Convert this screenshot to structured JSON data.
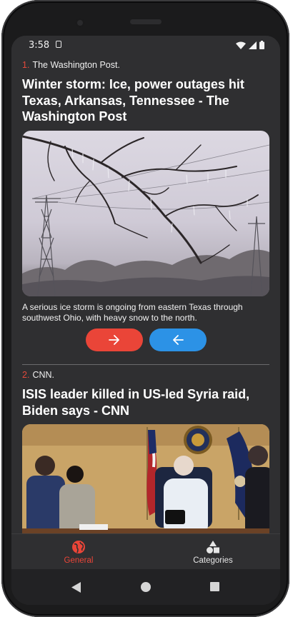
{
  "status_bar": {
    "time": "3:58",
    "icons": [
      "sim-card-icon",
      "wifi-icon",
      "signal-icon",
      "battery-icon"
    ]
  },
  "articles": [
    {
      "index": "1.",
      "source": "The Washington Post.",
      "title": "Winter storm: Ice, power outages hit Texas, Arkansas, Tennessee - The Washington Post",
      "image_alt": "Ice-covered tree branches with power lines in the background",
      "description": "A serious ice storm is ongoing from eastern Texas through southwest Ohio, with heavy snow to the north.",
      "buttons": [
        {
          "icon": "arrow-right-icon",
          "color": "#ea4538"
        },
        {
          "icon": "arrow-left-icon",
          "color": "#2c92e6"
        }
      ]
    },
    {
      "index": "2.",
      "source": "CNN.",
      "title": "ISIS leader killed in US-led Syria raid, Biden says - CNN",
      "image_alt": "Officials seated in a situation room with flags and a presidential seal"
    }
  ],
  "bottom_nav": {
    "items": [
      {
        "label": "General",
        "icon": "globe-icon",
        "active": true
      },
      {
        "label": "Categories",
        "icon": "shapes-icon",
        "active": false
      }
    ]
  },
  "system_nav": [
    "back-icon",
    "home-icon",
    "recents-icon"
  ],
  "colors": {
    "background": "#2f2f31",
    "accent": "#ea4538",
    "secondary": "#2c92e6",
    "index_number": "#e4493b"
  }
}
